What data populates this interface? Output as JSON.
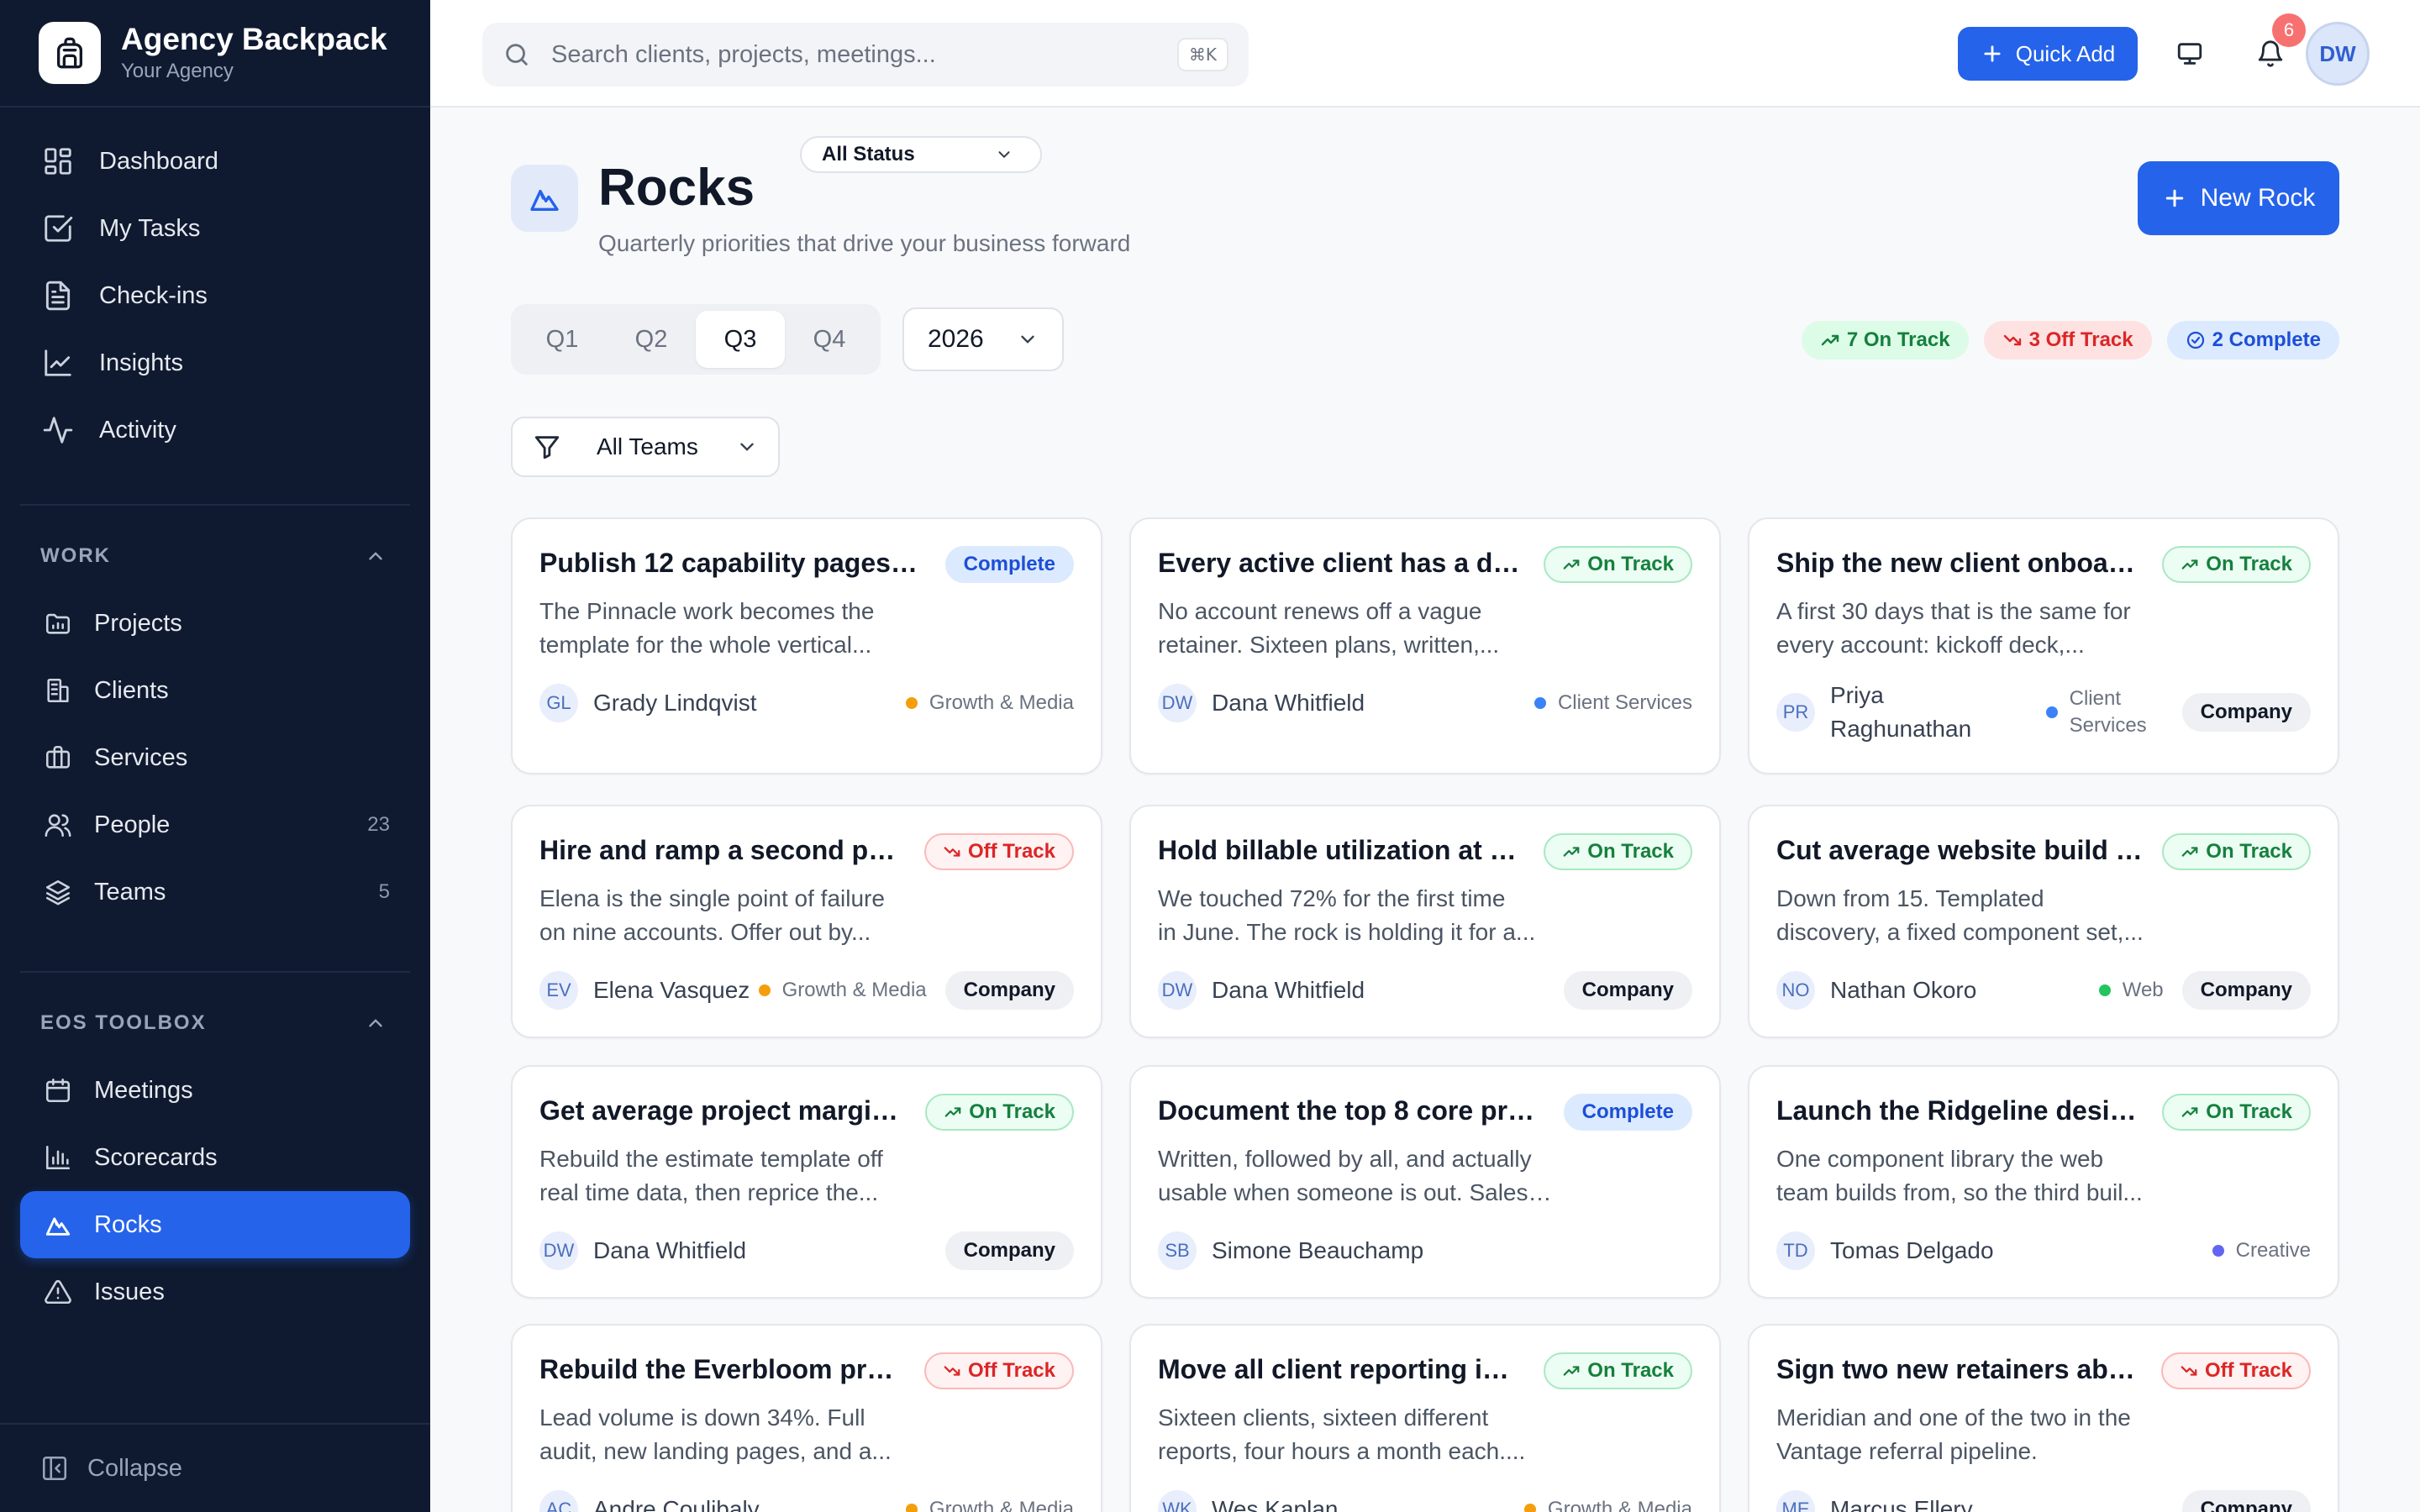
{
  "app": {
    "name": "Agency Backpack",
    "workspace": "Your Agency"
  },
  "nav": {
    "main": [
      {
        "label": "Dashboard",
        "icon": "dashboard-icon"
      },
      {
        "label": "My Tasks",
        "icon": "checkbox-icon"
      },
      {
        "label": "Check-ins",
        "icon": "document-icon"
      },
      {
        "label": "Insights",
        "icon": "chart-line-icon"
      },
      {
        "label": "Activity",
        "icon": "activity-icon"
      }
    ],
    "work_title": "WORK",
    "work": [
      {
        "label": "Projects",
        "icon": "folder-icon",
        "count": ""
      },
      {
        "label": "Clients",
        "icon": "building-icon",
        "count": ""
      },
      {
        "label": "Services",
        "icon": "briefcase-icon",
        "count": ""
      },
      {
        "label": "People",
        "icon": "users-icon",
        "count": "23"
      },
      {
        "label": "Teams",
        "icon": "layers-icon",
        "count": "5"
      }
    ],
    "eos_title": "EOS TOOLBOX",
    "eos": [
      {
        "label": "Meetings",
        "icon": "calendar-icon"
      },
      {
        "label": "Scorecards",
        "icon": "bar-chart-icon"
      },
      {
        "label": "Rocks",
        "icon": "mountain-icon",
        "active": true
      },
      {
        "label": "Issues",
        "icon": "warning-icon"
      }
    ],
    "collapse_label": "Collapse"
  },
  "topbar": {
    "search_placeholder": "Search clients, projects, meetings...",
    "shortcut": "⌘K",
    "quick_add": "Quick Add",
    "notification_count": "6",
    "user_initials": "DW"
  },
  "page": {
    "title": "Rocks",
    "subtitle": "Quarterly priorities that drive your business forward",
    "new_button": "New Rock",
    "quarters": [
      "Q1",
      "Q2",
      "Q3",
      "Q4"
    ],
    "active_quarter": "Q3",
    "year": "2026",
    "summary": {
      "on_track": "7 On Track",
      "off_track": "3 Off Track",
      "complete": "2 Complete"
    },
    "filters": {
      "teams": "All Teams",
      "status": "All Status"
    }
  },
  "colors": {
    "accent": "#2563eb",
    "sidebar_bg": "#0f1a30",
    "team_growth_media": "#f59e0b",
    "team_client_services": "#3b82f6",
    "team_web": "#22c55e",
    "team_creative": "#6366f1"
  },
  "rocks": [
    {
      "title": "Publish 12 capability pages fo...",
      "status": "Complete",
      "status_type": "complete",
      "desc": [
        "The Pinnacle work becomes the",
        "template for the whole vertical..."
      ],
      "initials": "GL",
      "owner": "Grady Lindqvist",
      "team": "Growth & Media",
      "team_color": "#f59e0b",
      "scope": ""
    },
    {
      "title": "Every active client has a do...",
      "status": "On Track",
      "status_type": "ontrack",
      "desc": [
        "No account renews off a vague",
        "retainer. Sixteen plans, written,..."
      ],
      "initials": "DW",
      "owner": "Dana Whitfield",
      "team": "Client Services",
      "team_color": "#3b82f6",
      "scope": ""
    },
    {
      "title": "Ship the new client onboard...",
      "status": "On Track",
      "status_type": "ontrack",
      "desc": [
        "A first 30 days that is the same for",
        "every account: kickoff deck,..."
      ],
      "initials": "PR",
      "owner": "Priya Raghunathan",
      "team": "Client Services",
      "team_color": "#3b82f6",
      "scope": "Company"
    },
    {
      "title": "Hire and ramp a second pai...",
      "status": "Off Track",
      "status_type": "offtrack",
      "desc": [
        "Elena is the single point of failure",
        "on nine accounts. Offer out by..."
      ],
      "initials": "EV",
      "owner": "Elena Vasquez",
      "team": "Growth & Media",
      "team_color": "#f59e0b",
      "scope": "Company"
    },
    {
      "title": "Hold billable utilization at 72...",
      "status": "On Track",
      "status_type": "ontrack",
      "desc": [
        "We touched 72% for the first time",
        "in June. The rock is holding it for a..."
      ],
      "initials": "DW",
      "owner": "Dana Whitfield",
      "team": "",
      "team_color": "",
      "scope": "Company"
    },
    {
      "title": "Cut average website build ti...",
      "status": "On Track",
      "status_type": "ontrack",
      "desc": [
        "Down from 15. Templated",
        "discovery, a fixed component set,..."
      ],
      "initials": "NO",
      "owner": "Nathan Okoro",
      "team": "Web",
      "team_color": "#22c55e",
      "scope": "Company"
    },
    {
      "title": "Get average project margin ...",
      "status": "On Track",
      "status_type": "ontrack",
      "desc": [
        "Rebuild the estimate template off",
        "real time data, then reprice the..."
      ],
      "initials": "DW",
      "owner": "Dana Whitfield",
      "team": "",
      "team_color": "",
      "scope": "Company"
    },
    {
      "title": "Document the top 8 core pro...",
      "status": "Complete",
      "status_type": "complete",
      "desc": [
        "Written, followed by all, and actually",
        "usable when someone is out. Sales,..."
      ],
      "initials": "SB",
      "owner": "Simone Beauchamp",
      "team": "",
      "team_color": "",
      "scope": ""
    },
    {
      "title": "Launch the Ridgeline design...",
      "status": "On Track",
      "status_type": "ontrack",
      "desc": [
        "One component library the web",
        "team builds from, so the third buil..."
      ],
      "initials": "TD",
      "owner": "Tomas Delgado",
      "team": "Creative",
      "team_color": "#6366f1",
      "scope": ""
    },
    {
      "title": "Rebuild the Everbloom prog...",
      "status": "Off Track",
      "status_type": "offtrack",
      "desc": [
        "Lead volume is down 34%. Full",
        "audit, new landing pages, and a..."
      ],
      "initials": "AC",
      "owner": "Andre Coulibaly",
      "team": "Growth & Media",
      "team_color": "#f59e0b",
      "scope": ""
    },
    {
      "title": "Move all client reporting int...",
      "status": "On Track",
      "status_type": "ontrack",
      "desc": [
        "Sixteen clients, sixteen different",
        "reports, four hours a month each...."
      ],
      "initials": "WK",
      "owner": "Wes Kaplan",
      "team": "Growth & Media",
      "team_color": "#f59e0b",
      "scope": ""
    },
    {
      "title": "Sign two new retainers abov...",
      "status": "Off Track",
      "status_type": "offtrack",
      "desc": [
        "Meridian and one of the two in the",
        "Vantage referral pipeline."
      ],
      "initials": "ME",
      "owner": "Marcus Ellery",
      "team": "",
      "team_color": "",
      "scope": "Company"
    }
  ]
}
